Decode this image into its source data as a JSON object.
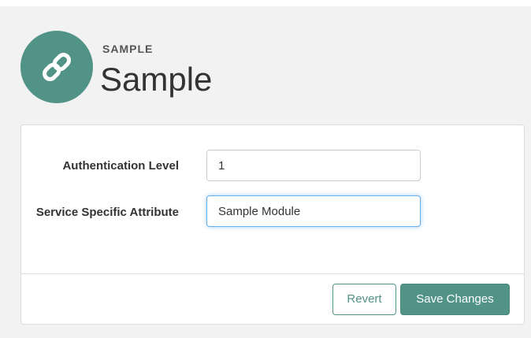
{
  "header": {
    "eyebrow": "SAMPLE",
    "title": "Sample",
    "logo_icon": "link-icon"
  },
  "form": {
    "fields": [
      {
        "label": "Authentication Level",
        "value": "1"
      },
      {
        "label": "Service Specific Attribute",
        "value": "Sample Module"
      }
    ]
  },
  "footer": {
    "revert_label": "Revert",
    "save_label": "Save Changes"
  },
  "colors": {
    "accent": "#519387",
    "background": "#f2f2f2",
    "panel": "#ffffff",
    "focus": "#66afe9"
  }
}
